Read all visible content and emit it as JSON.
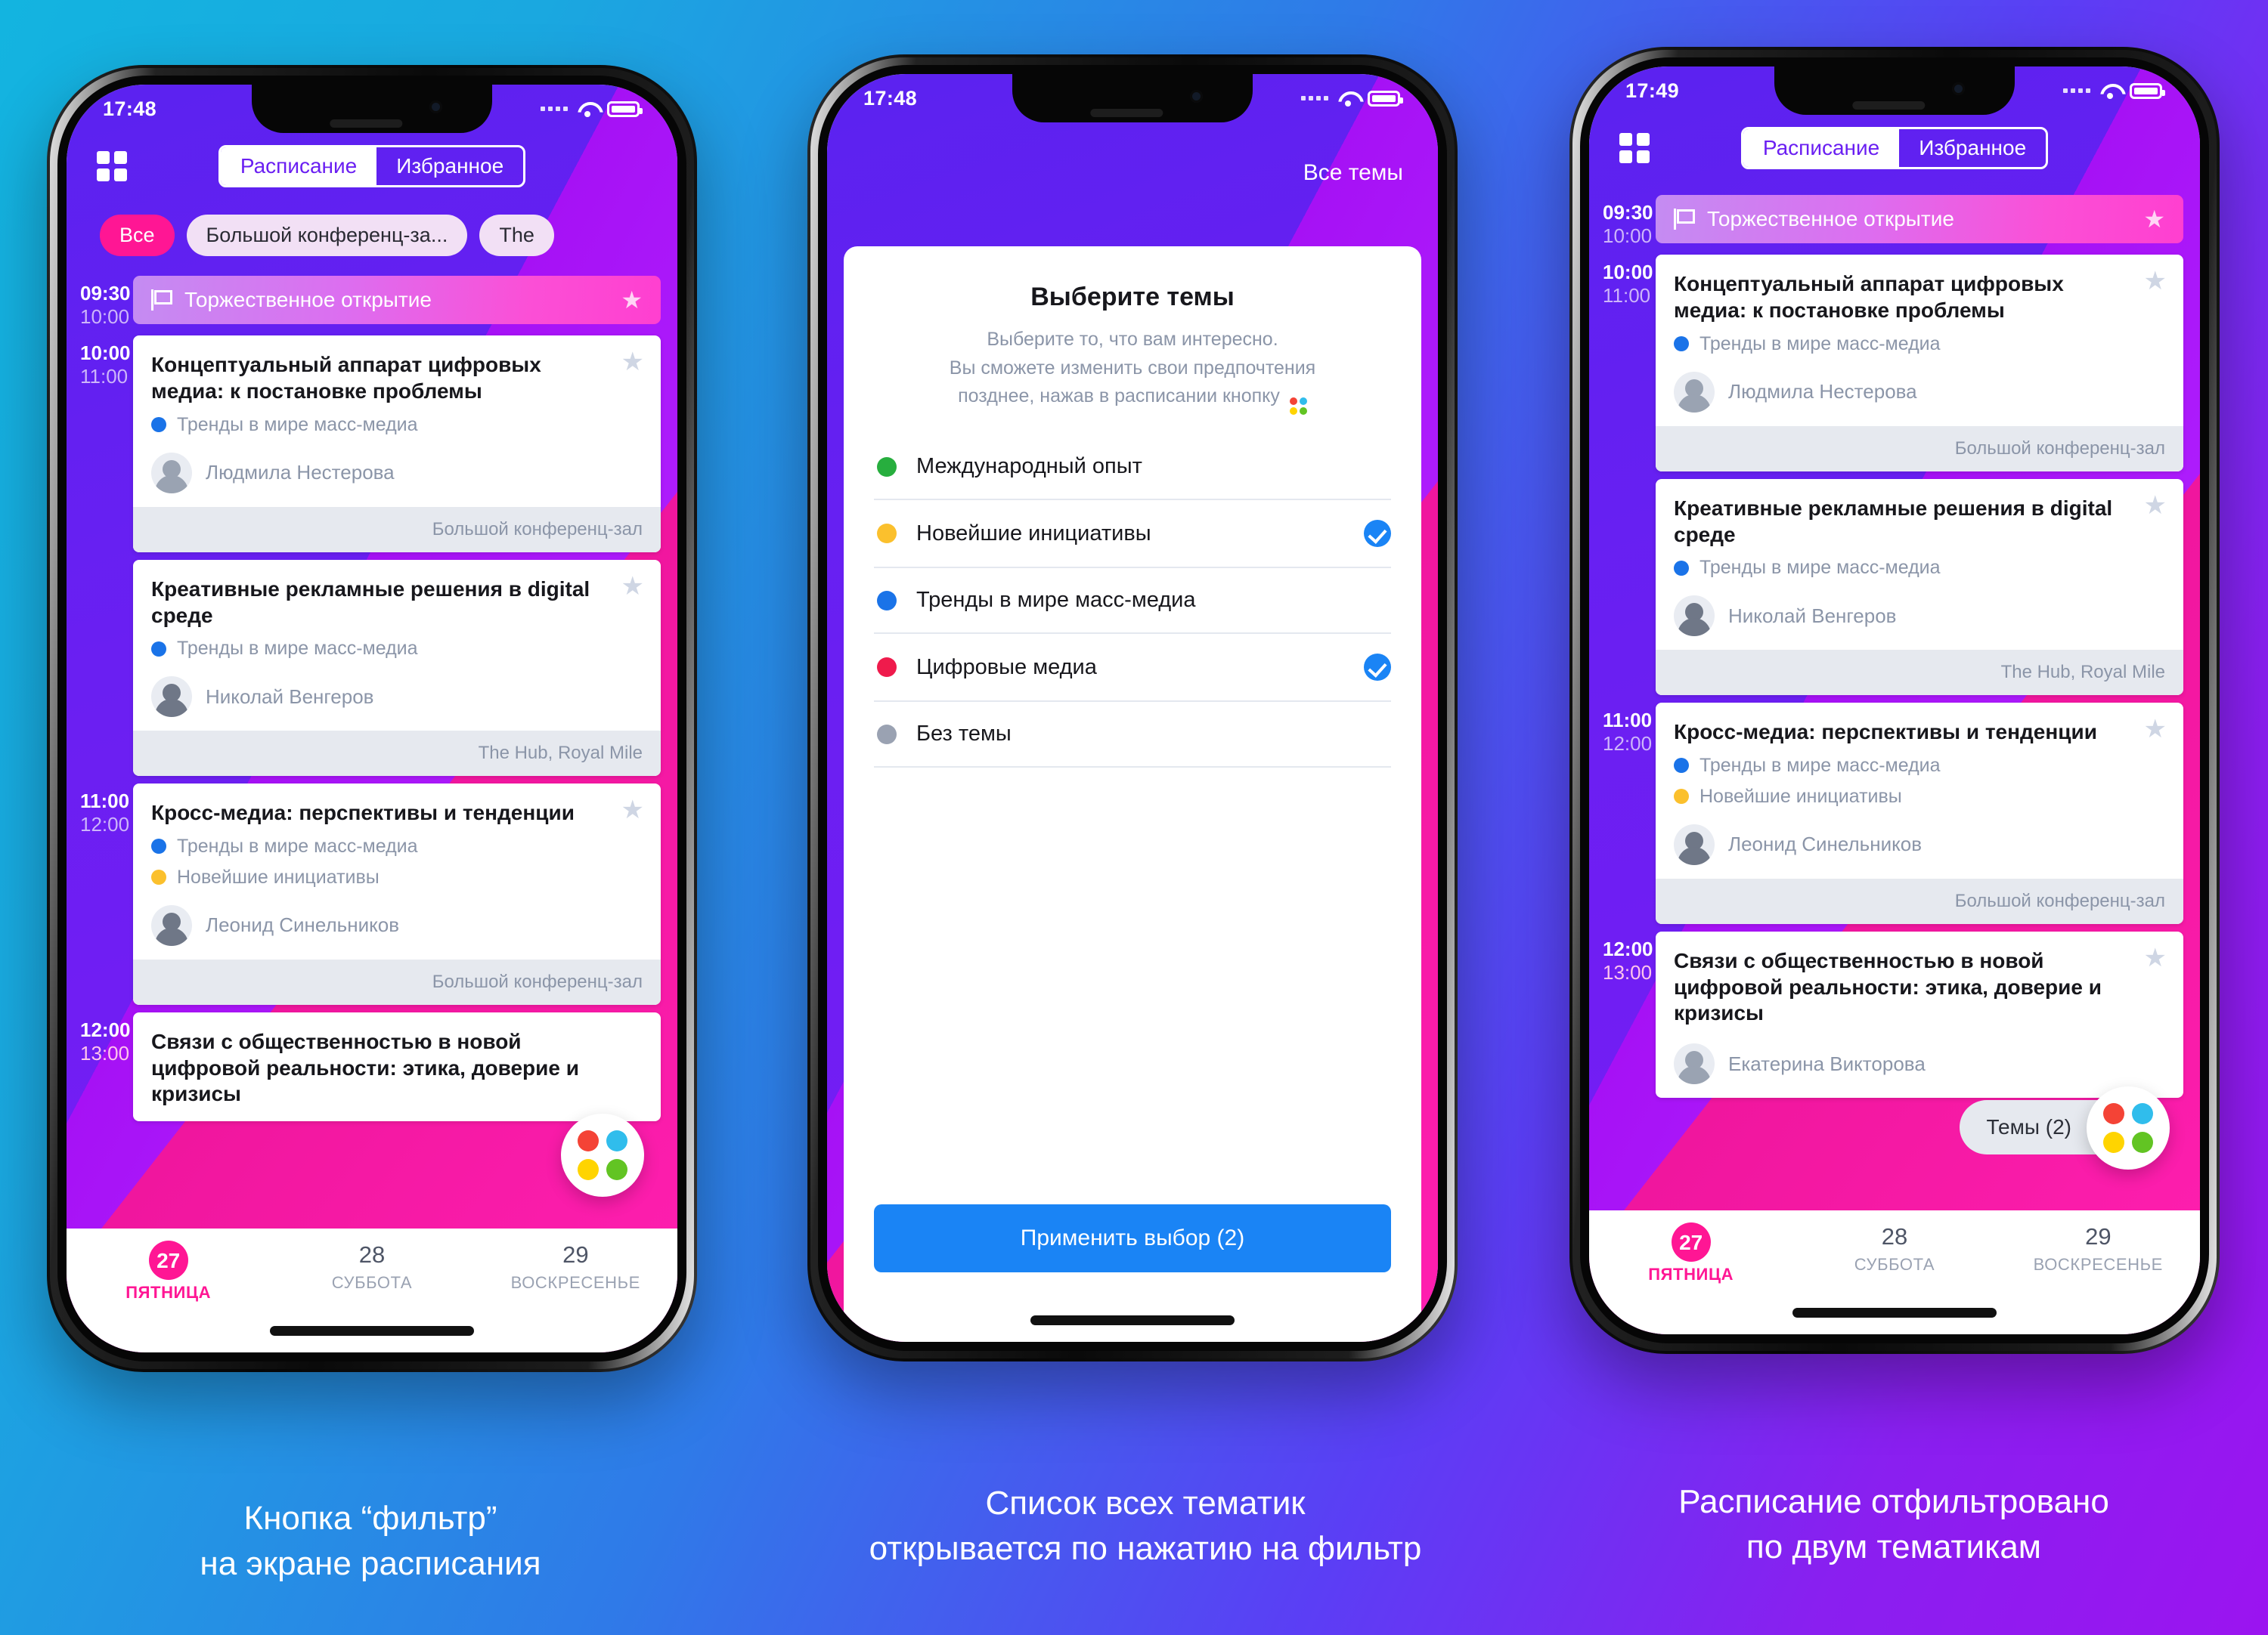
{
  "background": {
    "from": "#13b4e0",
    "to": "#9b14f0"
  },
  "colors": {
    "accent_pink": "#ff1694",
    "accent_blue": "#1a84f5",
    "purple": "#6a1ff2",
    "topic_green": "#27ae3e",
    "topic_yellow": "#fbc02d",
    "topic_blue": "#1a73e8",
    "topic_red": "#ef1b4c",
    "topic_grey": "#9aa2b2"
  },
  "phone1": {
    "status": {
      "time": "17:48",
      "wifi_icon": "wifi-icon",
      "battery_icon": "battery-icon",
      "signal_icon": "signal-dots-icon"
    },
    "nav": {
      "grid_icon": "grid-icon",
      "tabs": [
        {
          "label": "Расписание",
          "active": true
        },
        {
          "label": "Избранное",
          "active": false
        }
      ]
    },
    "chips": [
      {
        "label": "Все",
        "style": "pink"
      },
      {
        "label": "Большой конференц-за...",
        "style": "light"
      },
      {
        "label": "The",
        "style": "light"
      }
    ],
    "slots": [
      {
        "start": "09:30",
        "end": "10:00",
        "type": "opening",
        "title": "Торжественное открытие",
        "flag_icon": "flag-icon",
        "star_icon": "star-icon"
      },
      {
        "start": "10:00",
        "end": "11:00",
        "type": "session",
        "title": "Концептуальный аппарат цифровых медиа: к постановке проблемы",
        "topics": [
          {
            "label": "Тренды в мире масс-медиа",
            "color": "#1a73e8"
          }
        ],
        "speaker": "Людмила Нестерова",
        "venue": "Большой конференц-зал",
        "star_icon": "star-icon"
      },
      {
        "start": "",
        "end": "",
        "type": "session",
        "title": "Креативные рекламные решения в digital среде",
        "topics": [
          {
            "label": "Тренды в мире масс-медиа",
            "color": "#1a73e8"
          }
        ],
        "speaker": "Николай Венгеров",
        "venue": "The Hub, Royal Mile",
        "star_icon": "star-icon"
      },
      {
        "start": "11:00",
        "end": "12:00",
        "type": "session",
        "title": "Кросс-медиа: перспективы и тенденции",
        "topics": [
          {
            "label": "Тренды в мире масс-медиа",
            "color": "#1a73e8"
          },
          {
            "label": "Новейшие инициативы",
            "color": "#fbc02d"
          }
        ],
        "speaker": "Леонид Синельников",
        "venue": "Большой конференц-зал",
        "star_icon": "star-icon"
      },
      {
        "start": "12:00",
        "end": "13:00",
        "type": "session",
        "title": "Связи с общественностью в новой цифровой реальности: этика, доверие и кризисы",
        "topics": [],
        "speaker": "",
        "venue": "",
        "star_icon": "star-icon"
      }
    ],
    "fab": {
      "icon": "four-dots-icon",
      "dots": [
        "#f44336",
        "#30bdec",
        "#ffd400",
        "#62c423"
      ]
    },
    "days": [
      {
        "num": "27",
        "dow": "ПЯТНИЦА",
        "active": true
      },
      {
        "num": "28",
        "dow": "СУББОТА",
        "active": false
      },
      {
        "num": "29",
        "dow": "ВОСКРЕСЕНЬЕ",
        "active": false
      }
    ]
  },
  "phone2": {
    "status": {
      "time": "17:48"
    },
    "topbar_title": "Все темы",
    "sheet": {
      "title": "Выберите темы",
      "subtitle_line1": "Выберите то, что вам интересно.",
      "subtitle_line2": "Вы сможете изменить свои предпочтения",
      "subtitle_line3": "позднее, нажав в расписании кнопку",
      "inline_icon": "four-dots-icon",
      "topics": [
        {
          "label": "Международный опыт",
          "color": "#27ae3e",
          "checked": false
        },
        {
          "label": "Новейшие инициативы",
          "color": "#fbc02d",
          "checked": true
        },
        {
          "label": "Тренды в мире масс-медиа",
          "color": "#1a73e8",
          "checked": false
        },
        {
          "label": "Цифровые медиа",
          "color": "#ef1b4c",
          "checked": true
        },
        {
          "label": "Без темы",
          "color": "#9aa2b2",
          "checked": false
        }
      ],
      "apply_label": "Применить выбор (2)"
    }
  },
  "phone3": {
    "status": {
      "time": "17:49"
    },
    "nav": {
      "grid_icon": "grid-icon",
      "tabs": [
        {
          "label": "Расписание",
          "active": true
        },
        {
          "label": "Избранное",
          "active": false
        }
      ]
    },
    "slots": [
      {
        "start": "09:30",
        "end": "10:00",
        "type": "opening",
        "title": "Торжественное открытие",
        "flag_icon": "flag-icon",
        "star_icon": "star-icon"
      },
      {
        "start": "10:00",
        "end": "11:00",
        "type": "session",
        "title": "Концептуальный аппарат цифровых медиа: к постановке проблемы",
        "topics": [
          {
            "label": "Тренды в мире масс-медиа",
            "color": "#1a73e8"
          }
        ],
        "speaker": "Людмила Нестерова",
        "venue": "Большой конференц-зал",
        "star_icon": "star-icon"
      },
      {
        "start": "",
        "end": "",
        "type": "session",
        "title": "Креативные рекламные решения в digital среде",
        "topics": [
          {
            "label": "Тренды в мире масс-медиа",
            "color": "#1a73e8"
          }
        ],
        "speaker": "Николай Венгеров",
        "venue": "The Hub, Royal Mile",
        "star_icon": "star-icon"
      },
      {
        "start": "11:00",
        "end": "12:00",
        "type": "session",
        "title": "Кросс-медиа: перспективы и тенденции",
        "topics": [
          {
            "label": "Тренды в мире масс-медиа",
            "color": "#1a73e8"
          },
          {
            "label": "Новейшие инициативы",
            "color": "#fbc02d"
          }
        ],
        "speaker": "Леонид Синельников",
        "venue": "Большой конференц-зал",
        "star_icon": "star-icon"
      },
      {
        "start": "12:00",
        "end": "13:00",
        "type": "session",
        "title": "Связи с общественностью в новой цифровой реальности: этика, доверие и кризисы",
        "topics": [],
        "speaker": "Екатерина Викторова",
        "venue": "",
        "star_icon": "star-icon"
      }
    ],
    "fab": {
      "label": "Темы (2)",
      "icon": "four-dots-icon",
      "dots": [
        "#f44336",
        "#30bdec",
        "#ffd400",
        "#62c423"
      ]
    },
    "days": [
      {
        "num": "27",
        "dow": "ПЯТНИЦА",
        "active": true
      },
      {
        "num": "28",
        "dow": "СУББОТА",
        "active": false
      },
      {
        "num": "29",
        "dow": "ВОСКРЕСЕНЬЕ",
        "active": false
      }
    ]
  },
  "captions": {
    "one_line1": "Кнопка “фильтр”",
    "one_line2": "на экране расписания",
    "two_line1": "Список всех тематик",
    "two_line2": "открывается по нажатию на фильтр",
    "three_line1": "Расписание отфильтровано",
    "three_line2": "по двум тематикам"
  }
}
